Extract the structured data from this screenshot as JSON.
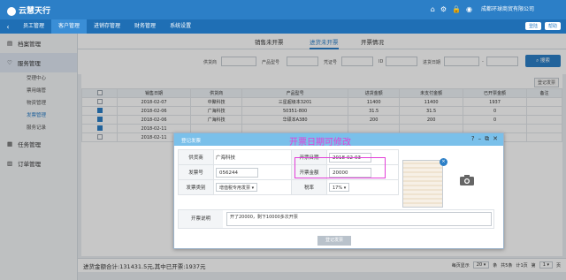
{
  "app": {
    "name": "云慧天行",
    "company": "成都环球商贸有限公司"
  },
  "nav": {
    "items": [
      "员工管理",
      "客户管理",
      "进销存管理",
      "财务管理",
      "系统设置"
    ],
    "active": 1,
    "logout": "登陆",
    "help": "帮助"
  },
  "sidebar": {
    "groups": [
      {
        "label": "档案管理",
        "icon": "file-icon"
      },
      {
        "label": "服务管理",
        "icon": "heart-icon",
        "sub": [
          "受理中心",
          "票用端管",
          "物资管理",
          "发票管理",
          "服务记录"
        ]
      },
      {
        "label": "任务管理",
        "icon": "task-icon"
      },
      {
        "label": "订单管理",
        "icon": "order-icon"
      }
    ]
  },
  "tabs": [
    "销售未开票",
    "进货未开票",
    "开票情况"
  ],
  "filter": {
    "labels": [
      "供货商",
      "产品型号",
      "凭证号",
      "ID",
      "进货日期"
    ],
    "search": "搜索",
    "date_sep": "-"
  },
  "table": {
    "register_btn": "登记发票",
    "headers": [
      "销售日期",
      "供货商",
      "产品型号",
      "进货金额",
      "未支付金额",
      "已开票金额",
      "备注"
    ],
    "rows": [
      {
        "checked": false,
        "cells": [
          "2018-02-07",
          "中聚科技",
          "三星超级本3201",
          "11400",
          "11400",
          "1937",
          ""
        ]
      },
      {
        "checked": true,
        "cells": [
          "2018-02-06",
          "广海科技",
          "50351-800",
          "31.5",
          "31.5",
          "0",
          ""
        ]
      },
      {
        "checked": true,
        "cells": [
          "2018-02-06",
          "广海科技",
          "华硕本A380",
          "200",
          "200",
          "0",
          ""
        ]
      },
      {
        "checked": true,
        "cells": [
          "2018-02-11",
          "",
          "",
          "",
          "",
          "",
          ""
        ]
      },
      {
        "checked": false,
        "cells": [
          "2018-02-11",
          "",
          "",
          "",
          "",
          "",
          ""
        ]
      }
    ]
  },
  "footer": {
    "totals": "进货金额合计:131431.5元,其中已开票:1937元",
    "page_size_label": "每页显示",
    "page_size": "20",
    "unit_rows": "条",
    "total_items": "共5条",
    "total_pages": "计1页",
    "page_label": "第",
    "page": "1",
    "unit_page": "页"
  },
  "dialog": {
    "title": "登记发票",
    "annotation": "开票日期可修改",
    "fields": {
      "supplier_label": "供货商",
      "supplier_value": "广海科技",
      "date_label": "开票日期",
      "date_value": "2018-02-03",
      "invoice_no_label": "发票号",
      "invoice_no_value": "056244",
      "amount_label": "开票金额",
      "amount_value": "20000",
      "type_label": "发票类别",
      "type_value": "增值税专用发票",
      "tax_label": "税率",
      "tax_value": "17%",
      "remark_label": "开票说明",
      "remark_value": "开了20000，剩下10000多次开票"
    },
    "submit": "登记发票"
  },
  "colors": {
    "primary": "#2c7fc7",
    "nav": "#1f6fb5",
    "dialog_title": "#7ac0ea",
    "annotation": "#e33fd8"
  }
}
